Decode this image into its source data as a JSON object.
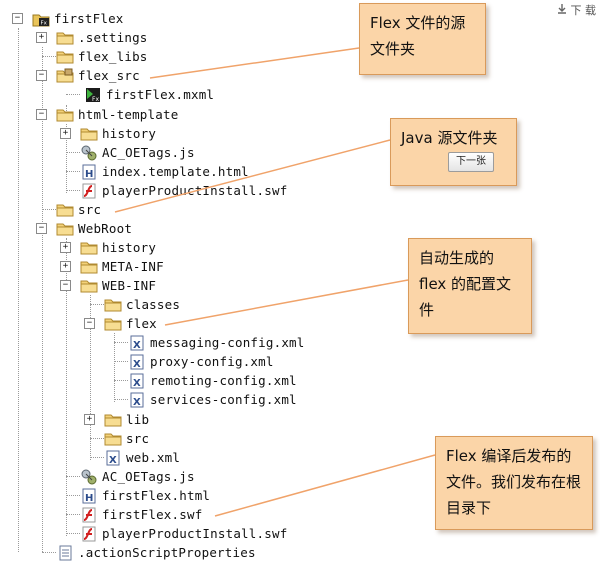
{
  "download": {
    "icon": "download-icon",
    "label": "下 载"
  },
  "tree": [
    {
      "id": "firstflex",
      "label": "firstFlex",
      "icon": "flex-project-icon",
      "toggle": "−"
    },
    {
      "id": "settings",
      "label": ".settings",
      "icon": "folder-icon",
      "toggle": "+"
    },
    {
      "id": "flex-libs",
      "label": "flex_libs",
      "icon": "folder-icon",
      "toggle": ""
    },
    {
      "id": "flex-src",
      "label": "flex_src",
      "icon": "source-folder-icon",
      "toggle": "−"
    },
    {
      "id": "firstflex-mxml",
      "label": "firstFlex.mxml",
      "icon": "mxml-file-icon",
      "toggle": ""
    },
    {
      "id": "html-template",
      "label": "html-template",
      "icon": "folder-icon",
      "toggle": "−"
    },
    {
      "id": "history-1",
      "label": "history",
      "icon": "folder-icon",
      "toggle": "+"
    },
    {
      "id": "ac-oetags-1",
      "label": "AC_OETags.js",
      "icon": "script-file-icon",
      "toggle": ""
    },
    {
      "id": "index-template",
      "label": "index.template.html",
      "icon": "html-file-icon",
      "toggle": ""
    },
    {
      "id": "player-install-1",
      "label": "playerProductInstall.swf",
      "icon": "swf-file-icon",
      "toggle": ""
    },
    {
      "id": "src",
      "label": "src",
      "icon": "folder-icon",
      "toggle": ""
    },
    {
      "id": "webroot",
      "label": "WebRoot",
      "icon": "folder-icon",
      "toggle": "−"
    },
    {
      "id": "history-2",
      "label": "history",
      "icon": "folder-icon",
      "toggle": "+"
    },
    {
      "id": "meta-inf",
      "label": "META-INF",
      "icon": "folder-icon",
      "toggle": "+"
    },
    {
      "id": "web-inf",
      "label": "WEB-INF",
      "icon": "folder-icon",
      "toggle": "−"
    },
    {
      "id": "classes",
      "label": "classes",
      "icon": "folder-icon",
      "toggle": ""
    },
    {
      "id": "flex",
      "label": "flex",
      "icon": "folder-icon",
      "toggle": "−"
    },
    {
      "id": "messaging-config",
      "label": "messaging-config.xml",
      "icon": "xml-file-icon",
      "toggle": ""
    },
    {
      "id": "proxy-config",
      "label": "proxy-config.xml",
      "icon": "xml-file-icon",
      "toggle": ""
    },
    {
      "id": "remoting-config",
      "label": "remoting-config.xml",
      "icon": "xml-file-icon",
      "toggle": ""
    },
    {
      "id": "services-config",
      "label": "services-config.xml",
      "icon": "xml-file-icon",
      "toggle": ""
    },
    {
      "id": "lib",
      "label": "lib",
      "icon": "folder-icon",
      "toggle": "+"
    },
    {
      "id": "src-2",
      "label": "src",
      "icon": "folder-icon",
      "toggle": ""
    },
    {
      "id": "web-xml",
      "label": "web.xml",
      "icon": "xml-file-icon",
      "toggle": ""
    },
    {
      "id": "ac-oetags-2",
      "label": "AC_OETags.js",
      "icon": "script-file-icon",
      "toggle": ""
    },
    {
      "id": "firstflex-html",
      "label": "firstFlex.html",
      "icon": "html-file-icon",
      "toggle": ""
    },
    {
      "id": "firstflex-swf",
      "label": "firstFlex.swf",
      "icon": "swf-file-icon",
      "toggle": ""
    },
    {
      "id": "player-install-2",
      "label": "playerProductInstall.swf",
      "icon": "swf-file-icon",
      "toggle": ""
    },
    {
      "id": "actionscript-props",
      "label": ".actionScriptProperties",
      "icon": "document-file-icon",
      "toggle": ""
    }
  ],
  "callouts": {
    "flex_source": "Flex 文件的源文件夹",
    "java_source": "Java 源文件夹",
    "next_button": "下一张",
    "generated_config": "自动生成的 flex 的配置文件",
    "compiled_output": "Flex 编译后发布的文件。我们发布在根目录下"
  },
  "colors": {
    "note_bg": "#fbd5a8",
    "note_border": "#d99a5a",
    "leader_line": "#f0a36a"
  }
}
